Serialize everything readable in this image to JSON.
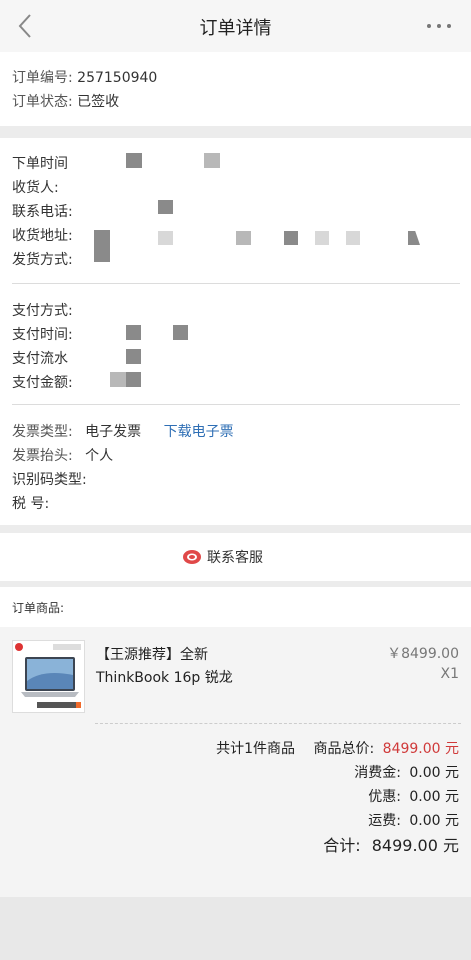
{
  "header": {
    "title": "订单详情"
  },
  "order": {
    "number_label": "订单编号:",
    "number": "257150940",
    "status_label": "订单状态:",
    "status": "已签收"
  },
  "shipping": {
    "order_time_label": "下单时间",
    "receiver_label": "收货人:",
    "phone_label": "联系电话:",
    "address_label": "收货地址:",
    "ship_method_label": "发货方式:"
  },
  "payment": {
    "method_label": "支付方式:",
    "time_label": "支付时间:",
    "serial_label": "支付流水",
    "amount_label": "支付金额:"
  },
  "invoice": {
    "type_label": "发票类型:",
    "type_value": "电子发票",
    "download_link": "下载电子票",
    "title_label": "发票抬头:",
    "title_value": "个人",
    "id_type_label": "识别码类型:",
    "tax_label": "税 号:"
  },
  "contact": {
    "label": "联系客服"
  },
  "items": {
    "header": "订单商品:",
    "product": {
      "name_line1": "【王源推荐】全新",
      "name_line2": "ThinkBook 16p 锐龙",
      "price": "￥8499.00",
      "qty": "X1"
    }
  },
  "summary": {
    "count_text": "共计1件商品",
    "goods_total_label": "商品总价:",
    "goods_total": "8499.00 元",
    "consume_label": "消费金:",
    "consume": "0.00 元",
    "discount_label": "优惠:",
    "discount": "0.00 元",
    "shipping_label": "运费:",
    "shipping": "0.00 元",
    "total_label": "合计:",
    "total": "8499.00 元"
  }
}
